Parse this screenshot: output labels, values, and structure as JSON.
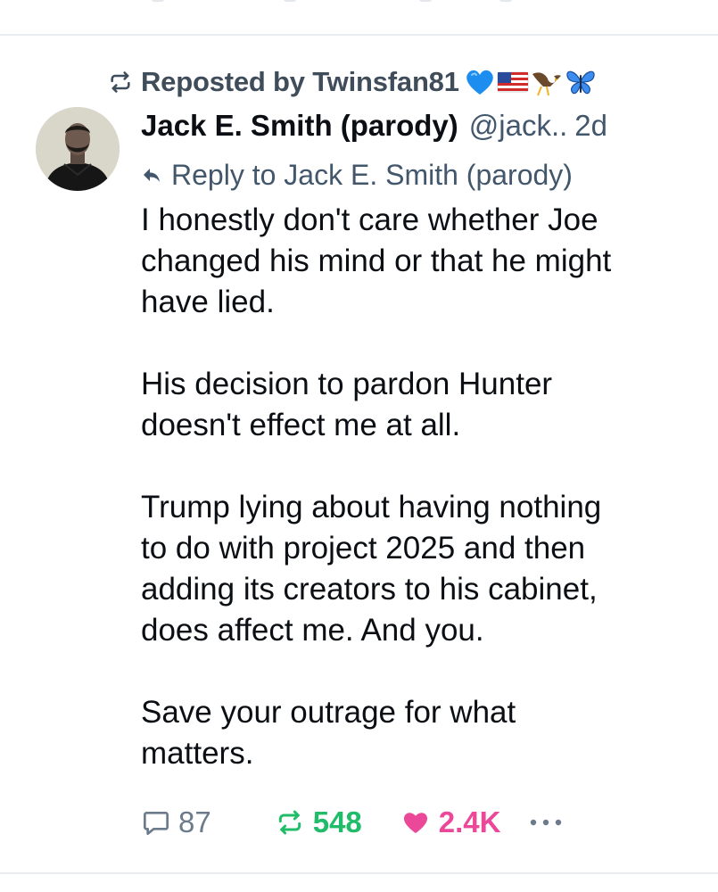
{
  "repost": {
    "label": "Reposted by Twinsfan81"
  },
  "post": {
    "author_name": "Jack E. Smith (parody)",
    "handle": "@jack..",
    "time": "2d",
    "reply_to_label": "Reply to Jack E. Smith (parody)",
    "paragraphs": [
      [
        "I honestly don't care whether Joe",
        "changed his mind or that he might",
        "have lied."
      ],
      [
        "His decision to pardon Hunter",
        "doesn't effect me at all."
      ],
      [
        "Trump lying about having nothing",
        "to do with project 2025 and then",
        "adding its creators to his cabinet,",
        "does affect me. And you."
      ],
      [
        "Save your outrage for what",
        "matters."
      ]
    ]
  },
  "actions": {
    "replies": "87",
    "reposts": "548",
    "likes": "2.4K"
  },
  "colors": {
    "muted": "#42576c",
    "repost_green": "#20bc6a",
    "like_pink": "#ec4899",
    "divider": "#e8ecf0"
  },
  "icons": {
    "repost": "repost-icon",
    "reply_to": "reply-arrow-icon",
    "reply": "speech-bubble-icon",
    "like": "heart-icon",
    "more": "ellipsis-icon",
    "emoji": [
      "blue-heart-emoji",
      "us-flag-emoji",
      "eagle-emoji",
      "butterfly-emoji"
    ]
  }
}
